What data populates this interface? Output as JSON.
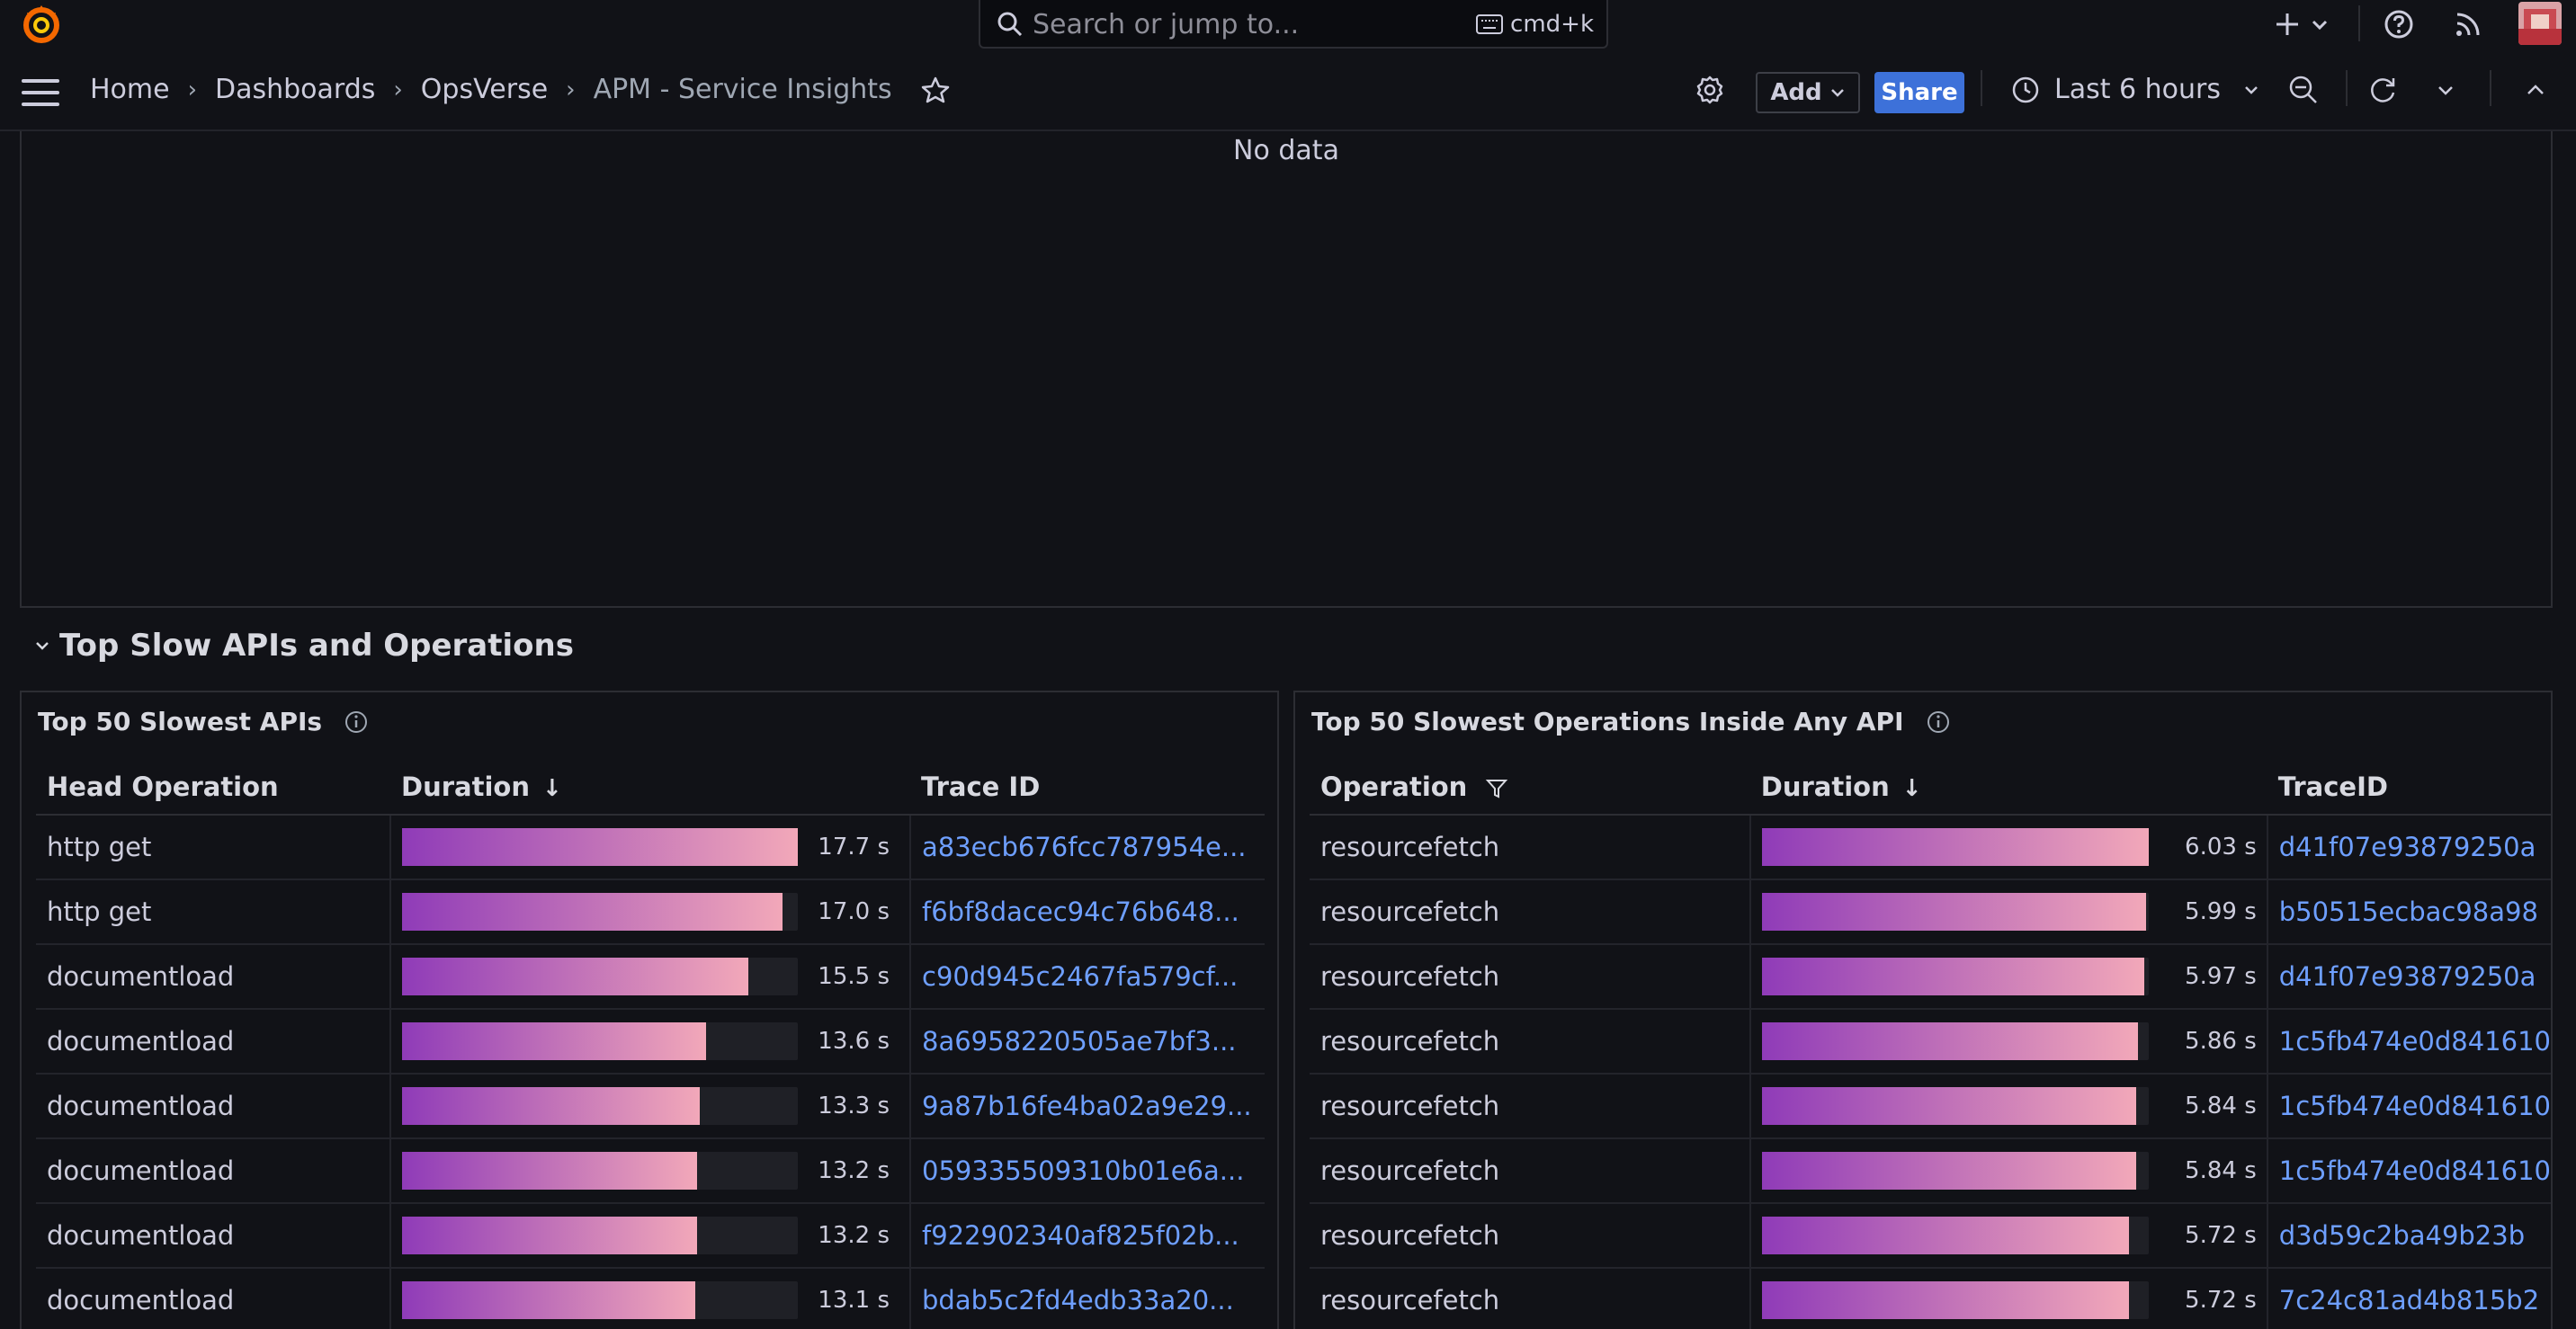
{
  "search": {
    "placeholder": "Search or jump to...",
    "shortcut": "cmd+k"
  },
  "breadcrumbs": [
    "Home",
    "Dashboards",
    "OpsVerse",
    "APM - Service Insights"
  ],
  "toolbar": {
    "add_label": "Add",
    "share_label": "Share",
    "time_range": "Last 6 hours"
  },
  "colors": {
    "accent": "#3d71d9",
    "link": "#6e9fff",
    "bar_start": "#8f3bb8",
    "bar_end": "#f2a8b9",
    "logo": "#f46800"
  },
  "top_panel": {
    "message": "No data"
  },
  "row": {
    "title": "Top Slow APIs and Operations"
  },
  "left_panel": {
    "title": "Top 50 Slowest APIs",
    "columns": [
      "Head Operation",
      "Duration",
      "Trace ID"
    ],
    "max": 17.7,
    "rows": [
      {
        "op": "http get",
        "value": 17.7,
        "label": "17.7 s",
        "trace": "a83ecb676fcc787954e..."
      },
      {
        "op": "http get",
        "value": 17.0,
        "label": "17.0 s",
        "trace": "f6bf8dacec94c76b648..."
      },
      {
        "op": "documentload",
        "value": 15.5,
        "label": "15.5 s",
        "trace": "c90d945c2467fa579cf..."
      },
      {
        "op": "documentload",
        "value": 13.6,
        "label": "13.6 s",
        "trace": "8a6958220505ae7bf3..."
      },
      {
        "op": "documentload",
        "value": 13.3,
        "label": "13.3 s",
        "trace": "9a87b16fe4ba02a9e29..."
      },
      {
        "op": "documentload",
        "value": 13.2,
        "label": "13.2 s",
        "trace": "059335509310b01e6a..."
      },
      {
        "op": "documentload",
        "value": 13.2,
        "label": "13.2 s",
        "trace": "f922902340af825f02b..."
      },
      {
        "op": "documentload",
        "value": 13.1,
        "label": "13.1 s",
        "trace": "bdab5c2fd4edb33a20..."
      }
    ]
  },
  "right_panel": {
    "title": "Top 50 Slowest Operations Inside Any API",
    "columns": [
      "Operation",
      "Duration",
      "TraceID"
    ],
    "max": 6.03,
    "rows": [
      {
        "op": "resourcefetch",
        "value": 6.03,
        "label": "6.03 s",
        "trace": "d41f07e93879250a"
      },
      {
        "op": "resourcefetch",
        "value": 5.99,
        "label": "5.99 s",
        "trace": "b50515ecbac98a98"
      },
      {
        "op": "resourcefetch",
        "value": 5.97,
        "label": "5.97 s",
        "trace": "d41f07e93879250a"
      },
      {
        "op": "resourcefetch",
        "value": 5.86,
        "label": "5.86 s",
        "trace": "1c5fb474e0d841610"
      },
      {
        "op": "resourcefetch",
        "value": 5.84,
        "label": "5.84 s",
        "trace": "1c5fb474e0d841610"
      },
      {
        "op": "resourcefetch",
        "value": 5.84,
        "label": "5.84 s",
        "trace": "1c5fb474e0d841610"
      },
      {
        "op": "resourcefetch",
        "value": 5.72,
        "label": "5.72 s",
        "trace": "d3d59c2ba49b23b"
      },
      {
        "op": "resourcefetch",
        "value": 5.72,
        "label": "5.72 s",
        "trace": "7c24c81ad4b815b2"
      }
    ]
  }
}
